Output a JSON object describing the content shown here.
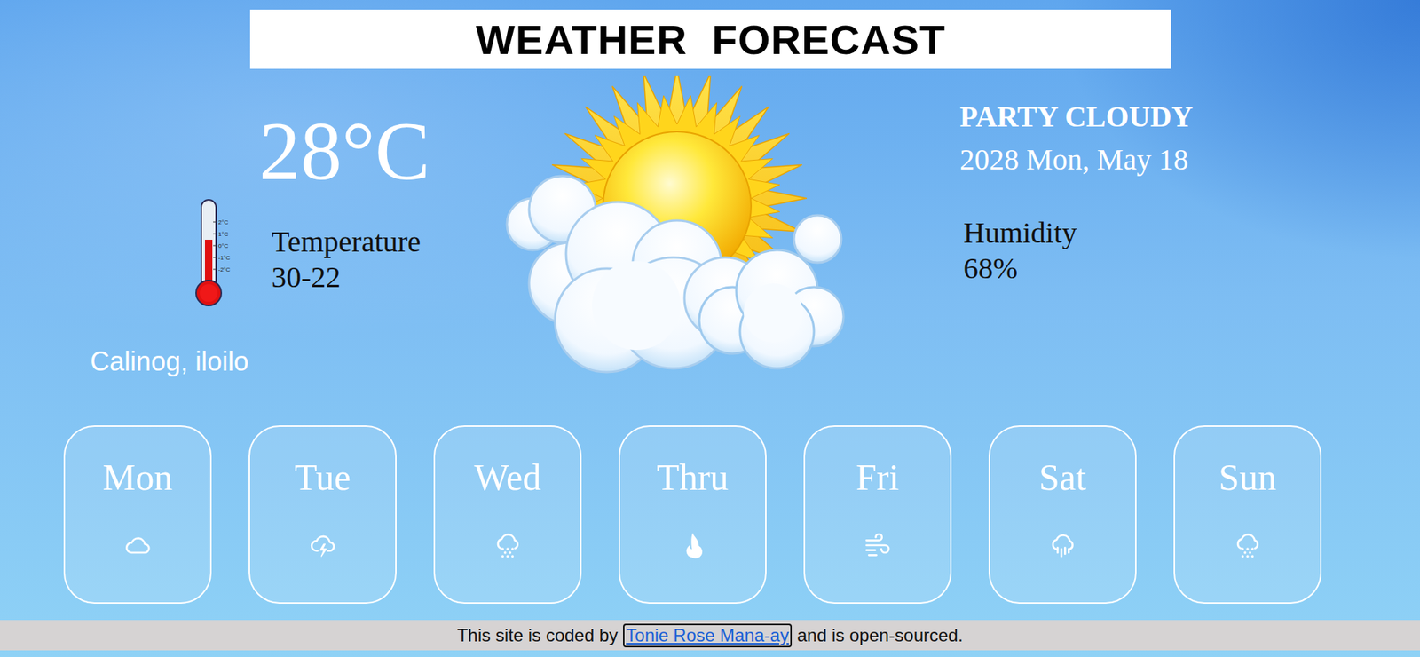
{
  "title": "WEATHER  FORECAST",
  "current": {
    "temperature": "28°C",
    "temperature_label": "Temperature",
    "temperature_range": "30-22",
    "condition": "PARTY CLOUDY",
    "date": "2028 Mon, May 18",
    "humidity_label": "Humidity",
    "humidity": "68%",
    "location": "Calinog, iloilo"
  },
  "thermometer": {
    "level": 0.62,
    "ticks": [
      "2°C",
      "1°C",
      "0°C",
      "-1°C",
      "-2°C"
    ]
  },
  "forecast": [
    {
      "day": "Mon",
      "kind": "cloud"
    },
    {
      "day": "Tue",
      "kind": "thunder"
    },
    {
      "day": "Wed",
      "kind": "snow"
    },
    {
      "day": "Thru",
      "kind": "fire"
    },
    {
      "day": "Fri",
      "kind": "wind"
    },
    {
      "day": "Sat",
      "kind": "rain"
    },
    {
      "day": "Sun",
      "kind": "snow"
    }
  ],
  "footer": {
    "before": "This site is coded by",
    "link": "Tonie Rose Mana-ay",
    "after": "and is open-sourced.",
    "link_focused": true
  }
}
